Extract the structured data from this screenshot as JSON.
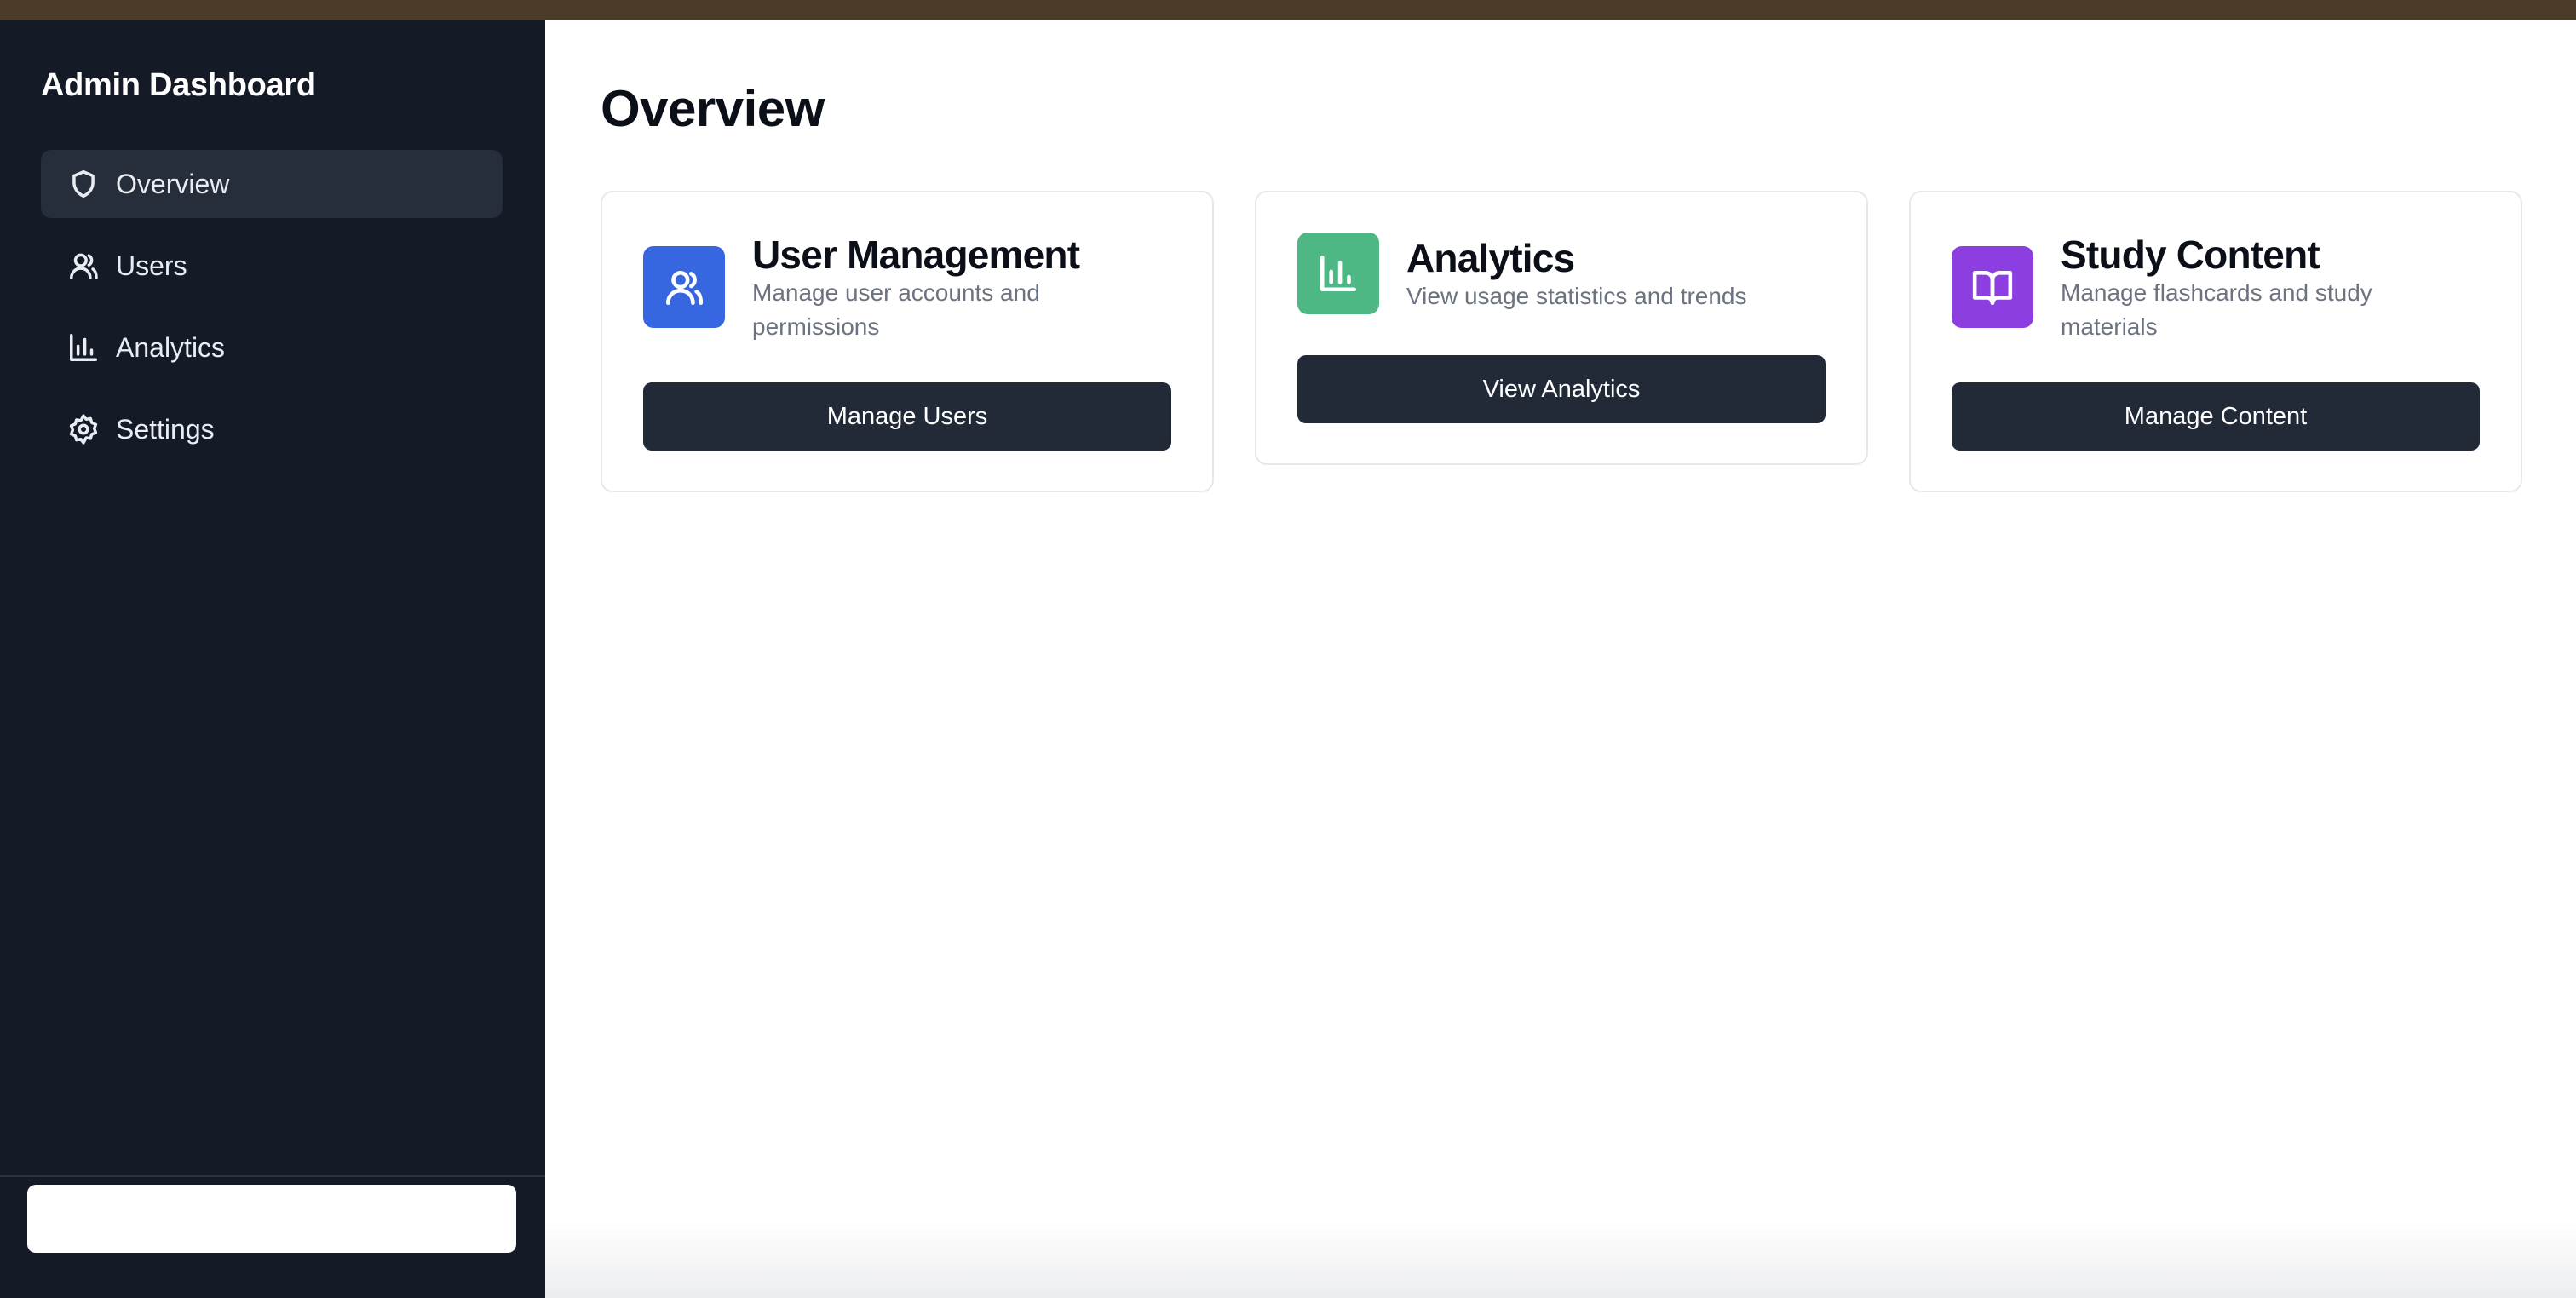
{
  "sidebar": {
    "title": "Admin Dashboard",
    "items": [
      {
        "label": "Overview",
        "icon": "shield-icon",
        "active": true
      },
      {
        "label": "Users",
        "icon": "users-icon",
        "active": false
      },
      {
        "label": "Analytics",
        "icon": "bar-chart-icon",
        "active": false
      },
      {
        "label": "Settings",
        "icon": "gear-icon",
        "active": false
      }
    ]
  },
  "main": {
    "title": "Overview",
    "cards": [
      {
        "title": "User Management",
        "description": "Manage user accounts and permissions",
        "button": "Manage Users",
        "icon": "users-icon",
        "color": "#3667e0"
      },
      {
        "title": "Analytics",
        "description": "View usage statistics and trends",
        "button": "View Analytics",
        "icon": "bar-chart-icon",
        "color": "#4db883"
      },
      {
        "title": "Study Content",
        "description": "Manage flashcards and study materials",
        "button": "Manage Content",
        "icon": "book-open-icon",
        "color": "#8c3ee0"
      }
    ]
  },
  "colors": {
    "sidebar_bg": "#141b27",
    "active_item_bg": "#262e3b",
    "button_bg": "#222a37",
    "topbar": "#4b3b29"
  }
}
